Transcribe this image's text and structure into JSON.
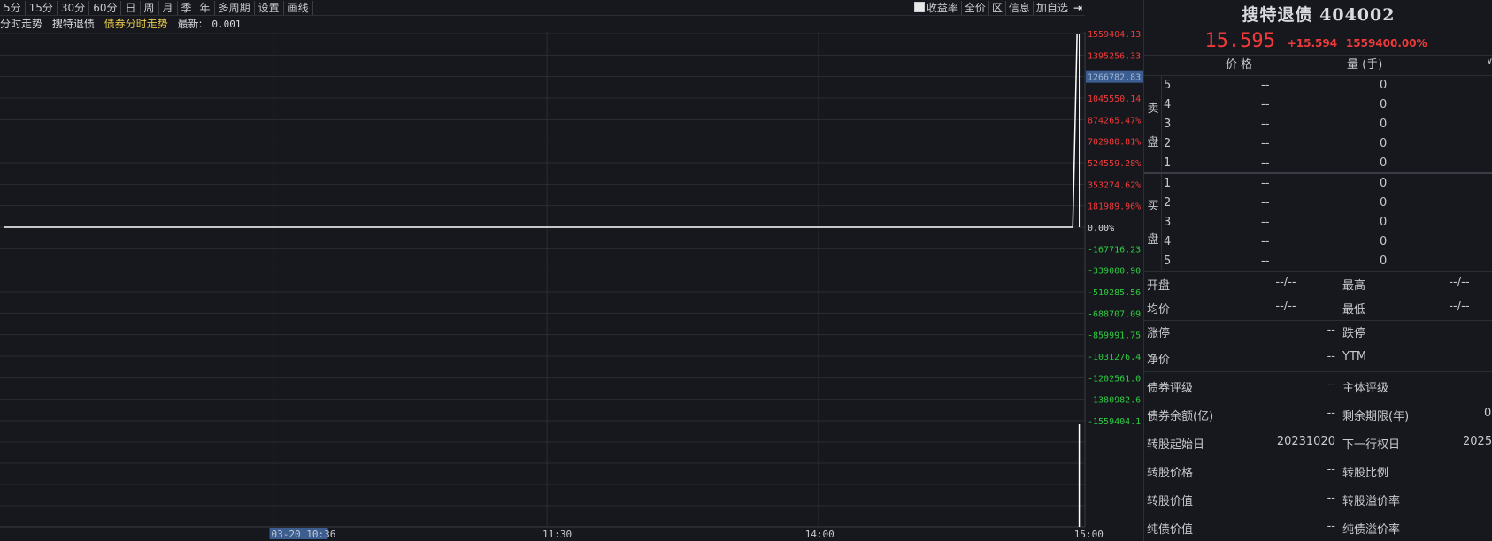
{
  "toolbar": {
    "periods": [
      "5分",
      "15分",
      "30分",
      "60分",
      "日",
      "周",
      "月",
      "季",
      "年",
      "多周期",
      "设置",
      "画线"
    ],
    "yield_label": "收益率",
    "full_price": "全价",
    "zone": "区",
    "info": "信息",
    "add_watch": "加自选"
  },
  "infobar": {
    "view": "分时走势",
    "name": "搜特退债",
    "chart_name": "债券分时走势",
    "latest_label": "最新:",
    "latest_value": "0.001"
  },
  "chart_data": {
    "type": "line",
    "x_labels": [
      "03-20 10:36",
      "11:30",
      "14:00",
      "15:00"
    ],
    "y_right_labels": [
      "1559404.13",
      "1395256.33",
      "1266782.83",
      "1045550.14",
      "874265.47%",
      "702980.81%",
      "524559.28%",
      "353274.62%",
      "181989.96%",
      "0.00%",
      "-167716.23",
      "-339000.90",
      "-510285.56",
      "-688707.09",
      "-859991.75",
      "-1031276.4",
      "-1202561.0",
      "-1380982.6",
      "-1559404.1"
    ],
    "y_label_colors": [
      "up",
      "up",
      "highlight",
      "up",
      "up",
      "up",
      "up",
      "up",
      "up",
      "zero",
      "down",
      "down",
      "down",
      "down",
      "down",
      "down",
      "down",
      "down",
      "down"
    ],
    "price_series": [
      {
        "x": 0,
        "y": 0
      },
      {
        "x": 0.992,
        "y": 0
      },
      {
        "x": 0.996,
        "y": 1559404.13
      }
    ],
    "volume_spike_x": 0.998,
    "colors": {
      "up": "#f23a3a",
      "down": "#2ecc40",
      "zero": "#d8dadf",
      "line": "#ffffff",
      "grid": "#2a2d33"
    }
  },
  "quote": {
    "title": "搜特退债 404002",
    "price": "15.595",
    "change": "+15.594",
    "pct": "1559400.00%"
  },
  "orderbook": {
    "col_price": "价 格",
    "col_volume": "量 (手)",
    "sell_label_1": "卖",
    "sell_label_2": "盘",
    "buy_label_1": "买",
    "buy_label_2": "盘",
    "sell_rows": [
      {
        "lvl": "5",
        "price": "--",
        "vol": "0"
      },
      {
        "lvl": "4",
        "price": "--",
        "vol": "0"
      },
      {
        "lvl": "3",
        "price": "--",
        "vol": "0"
      },
      {
        "lvl": "2",
        "price": "--",
        "vol": "0"
      },
      {
        "lvl": "1",
        "price": "--",
        "vol": "0"
      }
    ],
    "buy_rows": [
      {
        "lvl": "1",
        "price": "--",
        "vol": "0"
      },
      {
        "lvl": "2",
        "price": "--",
        "vol": "0"
      },
      {
        "lvl": "3",
        "price": "--",
        "vol": "0"
      },
      {
        "lvl": "4",
        "price": "--",
        "vol": "0"
      },
      {
        "lvl": "5",
        "price": "--",
        "vol": "0"
      }
    ]
  },
  "stats": {
    "open_l": "开盘",
    "open_v": "--/--",
    "high_l": "最高",
    "high_v": "--/--",
    "avg_l": "均价",
    "avg_v": "--/--",
    "low_l": "最低",
    "low_v": "--/--",
    "limit_up_l": "涨停",
    "limit_up_v": "--",
    "limit_down_l": "跌停",
    "net_l": "净价",
    "net_v": "--",
    "ytm_l": "YTM",
    "rating_l": "债券评级",
    "rating_v": "--",
    "issuer_l": "主体评级",
    "balance_l": "债券余额(亿)",
    "balance_v": "--",
    "term_l": "剩余期限(年)",
    "term_v": "0.",
    "conv_start_l": "转股起始日",
    "conv_start_v": "20231020",
    "next_put_l": "下一行权日",
    "next_put_v": "2025",
    "conv_price_l": "转股价格",
    "conv_price_v": "--",
    "conv_ratio_l": "转股比例",
    "conv_value_l": "转股价值",
    "conv_value_v": "--",
    "conv_prem_l": "转股溢价率",
    "bond_value_l": "纯债价值",
    "bond_value_v": "--",
    "bond_prem_l": "纯债溢价率"
  }
}
